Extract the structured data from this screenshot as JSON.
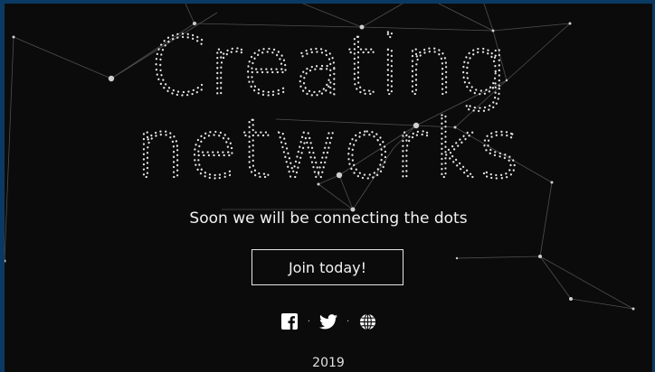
{
  "hero": {
    "title_line1": "Creating",
    "title_line2": "networks",
    "subtitle": "Soon we will be connecting the dots"
  },
  "cta": {
    "label": "Join today!"
  },
  "social": [
    {
      "icon": "facebook-icon"
    },
    {
      "icon": "twitter-icon"
    },
    {
      "icon": "globe-icon"
    }
  ],
  "social_separator": "·",
  "footer": {
    "year": "2019"
  },
  "colors": {
    "background": "#0b0b0b",
    "frame": "#0a3a63",
    "text": "#f2f2f2",
    "network_lines": "#5a5a5a",
    "network_dots": "#cfcfcf"
  }
}
